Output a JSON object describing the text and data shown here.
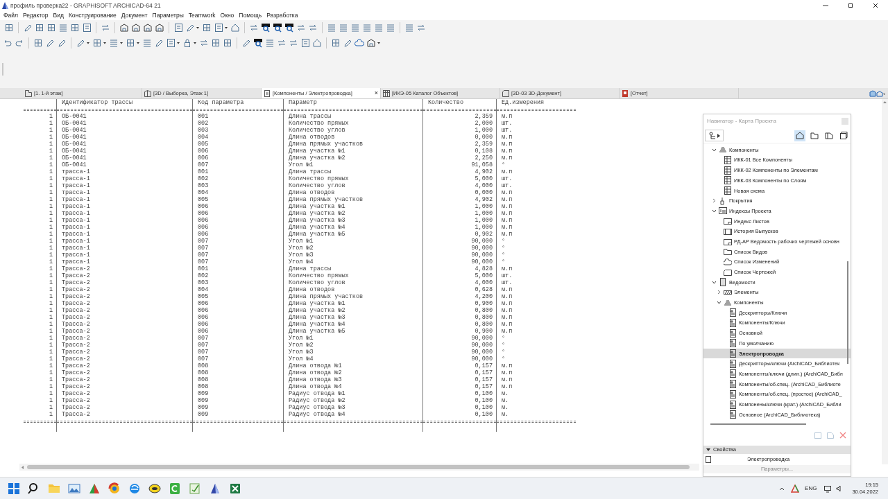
{
  "window": {
    "title": "профиль проверка22 - GRAPHISOFT ARCHICAD-64 21"
  },
  "menu": [
    "Файл",
    "Редактор",
    "Вид",
    "Конструирование",
    "Документ",
    "Параметры",
    "Teamwork",
    "Окно",
    "Помощь",
    "Разработка"
  ],
  "tabs": [
    {
      "label": "[1. 1-й этаж]",
      "kind": "plan",
      "selected": false
    },
    {
      "label": "[3D / Выборка, Этаж 1]",
      "kind": "model",
      "selected": false
    },
    {
      "label": "[Компоненты / Электропроводка]",
      "kind": "schedule",
      "selected": true,
      "close": "×"
    },
    {
      "label": "[ИКЭ-05 Каталог Объектов]",
      "kind": "catalog",
      "selected": false
    },
    {
      "label": "[3D-03 3D-Документ]",
      "kind": "document",
      "selected": false
    },
    {
      "label": "[Отчет]",
      "kind": "report",
      "selected": false
    }
  ],
  "report": {
    "headers": {
      "route_id": "Идентификатор трассы",
      "code": "Код параметра",
      "parameter": "Параметр",
      "quantity": "Количество",
      "unit": "Ед.измерения"
    },
    "rows": [
      {
        "count": "1",
        "route_id": "ОБ-0041",
        "code": "001",
        "parameter": "Длина трассы",
        "quantity": "2,359",
        "unit": "м.п"
      },
      {
        "count": "1",
        "route_id": "ОБ-0041",
        "code": "002",
        "parameter": "Количество прямых",
        "quantity": "2,000",
        "unit": "шт."
      },
      {
        "count": "1",
        "route_id": "ОБ-0041",
        "code": "003",
        "parameter": "Количество углов",
        "quantity": "1,000",
        "unit": "шт."
      },
      {
        "count": "1",
        "route_id": "ОБ-0041",
        "code": "004",
        "parameter": "Длина отводов",
        "quantity": "0,000",
        "unit": "м.п"
      },
      {
        "count": "1",
        "route_id": "ОБ-0041",
        "code": "005",
        "parameter": "Длина прямых участков",
        "quantity": "2,359",
        "unit": "м.п"
      },
      {
        "count": "1",
        "route_id": "ОБ-0041",
        "code": "006",
        "parameter": "Длина участка №1",
        "quantity": "0,108",
        "unit": "м.п"
      },
      {
        "count": "1",
        "route_id": "ОБ-0041",
        "code": "006",
        "parameter": "Длина участка №2",
        "quantity": "2,250",
        "unit": "м.п"
      },
      {
        "count": "1",
        "route_id": "ОБ-0041",
        "code": "007",
        "parameter": "Угол №1",
        "quantity": "91,058",
        "unit": "°"
      },
      {
        "count": "1",
        "route_id": "трасса-1",
        "code": "001",
        "parameter": "Длина трассы",
        "quantity": "4,902",
        "unit": "м.п"
      },
      {
        "count": "1",
        "route_id": "трасса-1",
        "code": "002",
        "parameter": "Количество прямых",
        "quantity": "5,000",
        "unit": "шт."
      },
      {
        "count": "1",
        "route_id": "трасса-1",
        "code": "003",
        "parameter": "Количество углов",
        "quantity": "4,000",
        "unit": "шт."
      },
      {
        "count": "1",
        "route_id": "трасса-1",
        "code": "004",
        "parameter": "Длина отводов",
        "quantity": "0,000",
        "unit": "м.п"
      },
      {
        "count": "1",
        "route_id": "трасса-1",
        "code": "005",
        "parameter": "Длина прямых участков",
        "quantity": "4,902",
        "unit": "м.п"
      },
      {
        "count": "1",
        "route_id": "трасса-1",
        "code": "006",
        "parameter": "Длина участка №1",
        "quantity": "1,000",
        "unit": "м.п"
      },
      {
        "count": "1",
        "route_id": "трасса-1",
        "code": "006",
        "parameter": "Длина участка №2",
        "quantity": "1,000",
        "unit": "м.п"
      },
      {
        "count": "1",
        "route_id": "трасса-1",
        "code": "006",
        "parameter": "Длина участка №3",
        "quantity": "1,000",
        "unit": "м.п"
      },
      {
        "count": "1",
        "route_id": "трасса-1",
        "code": "006",
        "parameter": "Длина участка №4",
        "quantity": "1,000",
        "unit": "м.п"
      },
      {
        "count": "1",
        "route_id": "трасса-1",
        "code": "006",
        "parameter": "Длина участка №5",
        "quantity": "0,902",
        "unit": "м.п"
      },
      {
        "count": "1",
        "route_id": "трасса-1",
        "code": "007",
        "parameter": "Угол №1",
        "quantity": "90,000",
        "unit": "°"
      },
      {
        "count": "1",
        "route_id": "трасса-1",
        "code": "007",
        "parameter": "Угол №2",
        "quantity": "90,000",
        "unit": "°"
      },
      {
        "count": "1",
        "route_id": "трасса-1",
        "code": "007",
        "parameter": "Угол №3",
        "quantity": "90,000",
        "unit": "°"
      },
      {
        "count": "1",
        "route_id": "трасса-1",
        "code": "007",
        "parameter": "Угол №4",
        "quantity": "90,000",
        "unit": "°"
      },
      {
        "count": "1",
        "route_id": "Трасса-2",
        "code": "001",
        "parameter": "Длина трассы",
        "quantity": "4,828",
        "unit": "м.п"
      },
      {
        "count": "1",
        "route_id": "Трасса-2",
        "code": "002",
        "parameter": "Количество прямых",
        "quantity": "5,000",
        "unit": "шт."
      },
      {
        "count": "1",
        "route_id": "Трасса-2",
        "code": "003",
        "parameter": "Количество углов",
        "quantity": "4,000",
        "unit": "шт."
      },
      {
        "count": "1",
        "route_id": "Трасса-2",
        "code": "004",
        "parameter": "Длина отводов",
        "quantity": "0,628",
        "unit": "м.п"
      },
      {
        "count": "1",
        "route_id": "Трасса-2",
        "code": "005",
        "parameter": "Длина прямых участков",
        "quantity": "4,200",
        "unit": "м.п"
      },
      {
        "count": "1",
        "route_id": "Трасса-2",
        "code": "006",
        "parameter": "Длина участка №1",
        "quantity": "0,900",
        "unit": "м.п"
      },
      {
        "count": "1",
        "route_id": "Трасса-2",
        "code": "006",
        "parameter": "Длина участка №2",
        "quantity": "0,800",
        "unit": "м.п"
      },
      {
        "count": "1",
        "route_id": "Трасса-2",
        "code": "006",
        "parameter": "Длина участка №3",
        "quantity": "0,800",
        "unit": "м.п"
      },
      {
        "count": "1",
        "route_id": "Трасса-2",
        "code": "006",
        "parameter": "Длина участка №4",
        "quantity": "0,800",
        "unit": "м.п"
      },
      {
        "count": "1",
        "route_id": "Трасса-2",
        "code": "006",
        "parameter": "Длина участка №5",
        "quantity": "0,900",
        "unit": "м.п"
      },
      {
        "count": "1",
        "route_id": "Трасса-2",
        "code": "007",
        "parameter": "Угол №1",
        "quantity": "90,000",
        "unit": "°"
      },
      {
        "count": "1",
        "route_id": "Трасса-2",
        "code": "007",
        "parameter": "Угол №2",
        "quantity": "90,000",
        "unit": "°"
      },
      {
        "count": "1",
        "route_id": "Трасса-2",
        "code": "007",
        "parameter": "Угол №3",
        "quantity": "90,000",
        "unit": "°"
      },
      {
        "count": "1",
        "route_id": "Трасса-2",
        "code": "007",
        "parameter": "Угол №4",
        "quantity": "90,000",
        "unit": "°"
      },
      {
        "count": "1",
        "route_id": "Трасса-2",
        "code": "008",
        "parameter": "Длина отвода №1",
        "quantity": "0,157",
        "unit": "м.п"
      },
      {
        "count": "1",
        "route_id": "Трасса-2",
        "code": "008",
        "parameter": "Длина отвода №2",
        "quantity": "0,157",
        "unit": "м.п"
      },
      {
        "count": "1",
        "route_id": "Трасса-2",
        "code": "008",
        "parameter": "Длина отвода №3",
        "quantity": "0,157",
        "unit": "м.п"
      },
      {
        "count": "1",
        "route_id": "Трасса-2",
        "code": "008",
        "parameter": "Длина отвода №4",
        "quantity": "0,157",
        "unit": "м.п"
      },
      {
        "count": "1",
        "route_id": "Трасса-2",
        "code": "009",
        "parameter": "Радиус отвода №1",
        "quantity": "0,100",
        "unit": "м."
      },
      {
        "count": "1",
        "route_id": "Трасса-2",
        "code": "009",
        "parameter": "Радиус отвода №2",
        "quantity": "0,100",
        "unit": "м."
      },
      {
        "count": "1",
        "route_id": "Трасса-2",
        "code": "009",
        "parameter": "Радиус отвода №3",
        "quantity": "0,100",
        "unit": "м."
      },
      {
        "count": "1",
        "route_id": "Трасса-2",
        "code": "009",
        "parameter": "Радиус отвода №4",
        "quantity": "0,100",
        "unit": "м."
      }
    ]
  },
  "navigator": {
    "title": "Навигатор - Карта Проекта",
    "tree": [
      {
        "label": "Компоненты",
        "kind": "group",
        "expanded": true,
        "selected": false,
        "children": [
          {
            "label": "ИКК-01 Все Компоненты",
            "kind": "table",
            "selected": false
          },
          {
            "label": "ИКК-02 Компоненты по Элементам",
            "kind": "table",
            "selected": false
          },
          {
            "label": "ИКК-03 Компоненты по Слоям",
            "kind": "table",
            "selected": false
          },
          {
            "label": "Новая схема",
            "kind": "table",
            "selected": false
          }
        ]
      },
      {
        "label": "Покрытия",
        "kind": "brush",
        "expanded": false,
        "selected": false
      },
      {
        "label": "Индексы Проекта",
        "kind": "index",
        "expanded": true,
        "selected": false,
        "children": [
          {
            "label": "Индекс Листов",
            "kind": "sheet",
            "selected": false
          },
          {
            "label": "История Выпусков",
            "kind": "history",
            "selected": false
          },
          {
            "label": "РД-АР Ведомость рабочих чертежей основн",
            "kind": "sheet",
            "selected": false
          },
          {
            "label": "Список Видов",
            "kind": "views",
            "selected": false
          },
          {
            "label": "Список Изменений",
            "kind": "changes",
            "selected": false
          },
          {
            "label": "Список Чертежей",
            "kind": "drawings",
            "selected": false
          }
        ]
      },
      {
        "label": "Ведомости",
        "kind": "schedule",
        "expanded": true,
        "selected": false,
        "children": [
          {
            "label": "Элементы",
            "kind": "hatch",
            "expanded": false,
            "selected": false
          },
          {
            "label": "Компоненты",
            "kind": "group",
            "expanded": true,
            "selected": false,
            "children": [
              {
                "label": "Дескрипторы/Ключи",
                "kind": "report",
                "selected": false
              },
              {
                "label": "Компоненты/Ключи",
                "kind": "report",
                "selected": false
              },
              {
                "label": "Основной",
                "kind": "report",
                "selected": false
              },
              {
                "label": "По умолчанию",
                "kind": "report",
                "selected": false
              },
              {
                "label": "Электропроводка",
                "kind": "report",
                "selected": true
              },
              {
                "label": "Дескрипторы/ключи (ArchiCAD_Библиотек",
                "kind": "report",
                "selected": false
              },
              {
                "label": "Компоненты/ключи (длин.) (ArchiCAD_Библ",
                "kind": "report",
                "selected": false
              },
              {
                "label": "Компоненты/об.спец. (ArchiCAD_Библиоте",
                "kind": "report",
                "selected": false
              },
              {
                "label": "Компоненты/об.спец. (простое) (ArchiCAD_",
                "kind": "report",
                "selected": false
              },
              {
                "label": "Компонены/ключи (крат.) (ArchiCAD_Библи",
                "kind": "report",
                "selected": false
              },
              {
                "label": "Основное (ArchiCAD_Библиотека)",
                "kind": "report",
                "selected": false
              }
            ]
          }
        ]
      }
    ],
    "properties": {
      "title": "Свойства",
      "expanded": true,
      "value": "Электропроводка",
      "button": "Параметры..."
    }
  },
  "taskbar": {
    "language": "ENG",
    "time": "19:15",
    "date": "30.04.2022"
  }
}
